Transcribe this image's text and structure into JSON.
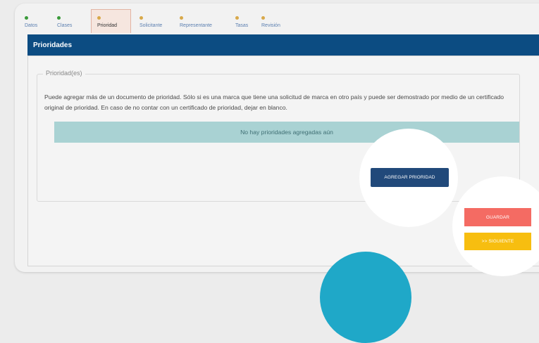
{
  "steps": [
    {
      "label": "Datos",
      "status_color": "#3a9a3a"
    },
    {
      "label": "Clases",
      "status_color": "#3a9a3a"
    },
    {
      "label": "Prioridad",
      "status_color": "#d8a94a"
    },
    {
      "label": "Solicitante",
      "status_color": "#d8a94a"
    },
    {
      "label": "Representante",
      "status_color": "#d8a94a"
    },
    {
      "label": "Tasas",
      "status_color": "#d8a94a"
    },
    {
      "label": "Revisión",
      "status_color": "#d8a94a"
    }
  ],
  "active_step": "Prioridad",
  "section": {
    "title": "Prioridades",
    "fieldset_legend": "Prioridad(es)",
    "description": "Puede agregar más de un documento de prioridad. Sólo si es una marca que tiene una solicitud de marca en otro país y puede ser demostrado por medio de un certificado original de prioridad. En caso de no contar con un certificado de prioridad, dejar en blanco.",
    "empty_message": "No hay prioridades agregadas aún"
  },
  "buttons": {
    "add_priority": "AGREGAR PRIORIDAD",
    "save": "GUARDAR",
    "next": ">> SIGUIENTE"
  },
  "colors": {
    "banner": "#0c4c82",
    "empty_box": "#a9d2d3",
    "add_button": "#21497a",
    "save_button": "#f46b63",
    "next_button": "#f7be10",
    "accent_circle": "#1fa8c8"
  }
}
